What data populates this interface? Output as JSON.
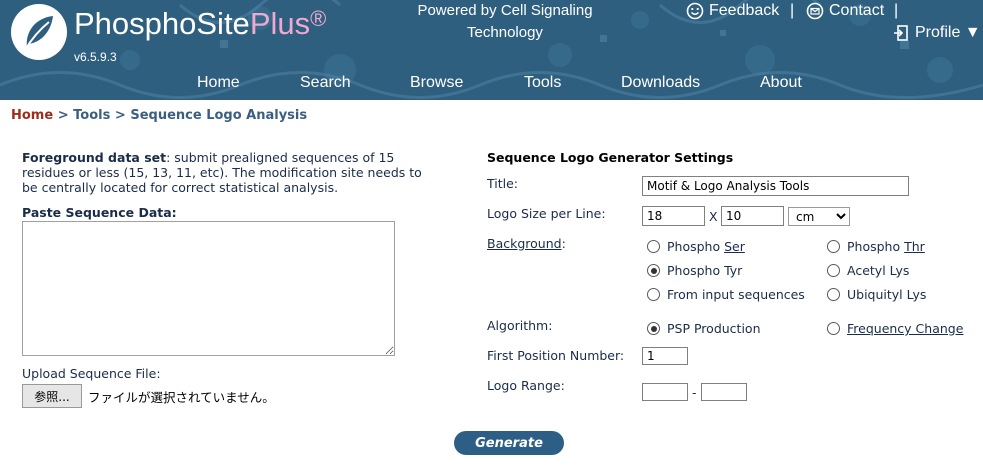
{
  "header": {
    "brand_main": "PhosphoSite",
    "brand_plus": "Plus",
    "brand_reg": "®",
    "version": "v6.5.9.3",
    "powered_line1": "Powered by Cell Signaling",
    "powered_line2": "Technology",
    "feedback_label": "Feedback",
    "contact_label": "Contact",
    "profile_label": "Profile ▼",
    "separator": "|",
    "nav": [
      "Home",
      "Search",
      "Browse",
      "Tools",
      "Downloads",
      "About"
    ]
  },
  "breadcrumb": {
    "home": "Home",
    "sep": ">",
    "tools": "Tools",
    "current": "Sequence Logo Analysis"
  },
  "left": {
    "fg_bold": "Foreground data set",
    "fg_text": ": submit prealigned sequences of 15 residues or less (15, 13, 11, etc). The modification site needs to be centrally located for correct statistical analysis.",
    "paste_label": "Paste Sequence Data:",
    "textarea_value": "",
    "upload_label": "Upload Sequence File:",
    "browse_label": "参照...",
    "file_status": "ファイルが選択されていません。"
  },
  "settings": {
    "title": "Sequence Logo Generator Settings",
    "title_label": "Title:",
    "title_value": "Motif & Logo Analysis Tools",
    "size_label": "Logo Size per Line:",
    "size_w": "18",
    "size_x": "X",
    "size_h": "10",
    "size_unit": "cm",
    "background_label": "Background",
    "background_colon": ":",
    "background_options": [
      {
        "prefix": "Phospho ",
        "link": "Ser",
        "selected": false
      },
      {
        "prefix": "Phospho ",
        "link": "Thr",
        "selected": false
      },
      {
        "prefix": "Phospho Tyr",
        "link": "",
        "selected": true
      },
      {
        "prefix": "Acetyl Lys",
        "link": "",
        "selected": false
      },
      {
        "prefix": "From input sequences",
        "link": "",
        "selected": false
      },
      {
        "prefix": "Ubiquityl Lys",
        "link": "",
        "selected": false
      }
    ],
    "algorithm_label": "Algorithm:",
    "algorithm_options": [
      {
        "prefix": "PSP Production",
        "link": "",
        "selected": true
      },
      {
        "prefix": "",
        "link": "Frequency Change",
        "selected": false
      }
    ],
    "first_pos_label": "First Position Number:",
    "first_pos_value": "1",
    "range_label": "Logo Range:",
    "range_from": "",
    "range_dash": "-",
    "range_to": ""
  },
  "generate_label": "Generate",
  "colors": {
    "header_bg": "#2f5f7f",
    "breadcrumb_home": "#9a2d1c",
    "breadcrumb_text": "#3b5f80",
    "generate_bg": "#2d5f86",
    "brand_plus": "#f0a8d0"
  }
}
